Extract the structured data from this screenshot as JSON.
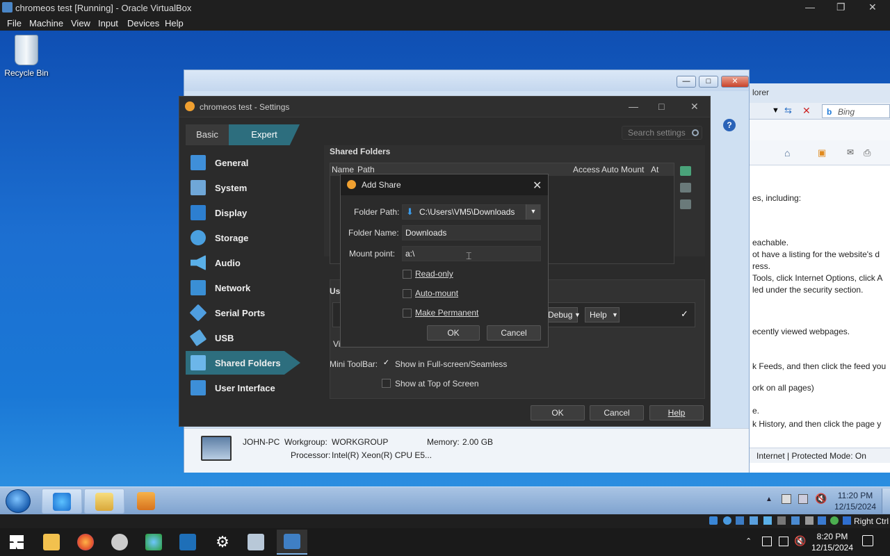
{
  "host": {
    "window_title": "chromeos test [Running] - Oracle VirtualBox",
    "menu": [
      "File",
      "Machine",
      "View",
      "Input",
      "Devices",
      "Help"
    ],
    "status_right": "Right Ctrl",
    "clock_time": "8:20 PM",
    "clock_date": "12/15/2024"
  },
  "desktop": {
    "recycle_bin": "Recycle Bin"
  },
  "ie": {
    "title_partial": "lorer",
    "search_placeholder": "Bing",
    "lines": [
      "es, including:",
      "eachable.",
      "ot have a listing for the website's d",
      "ress.",
      "Tools, click Internet Options, click A",
      "led under the security section.",
      "ecently viewed webpages.",
      "k Feeds, and then click the feed you",
      "ork on all pages)",
      "e.",
      "k History, and then click the page y"
    ],
    "status": "Internet | Protected Mode: On",
    "pc_name": "JOHN-PC",
    "workgroup_label": "Workgroup:",
    "workgroup_value": "WORKGROUP",
    "memory_label": "Memory:",
    "memory_value": "2.00 GB",
    "processor_label": "Processor:",
    "processor_value": "Intel(R) Xeon(R) CPU E5..."
  },
  "settings": {
    "title": "chromeos test - Settings",
    "tab_basic": "Basic",
    "tab_expert": "Expert",
    "search_placeholder": "Search settings",
    "nav": [
      {
        "label": "General",
        "icon": "general-icon",
        "color": "#3f8fd9"
      },
      {
        "label": "System",
        "icon": "system-icon",
        "color": "#6fa7d8"
      },
      {
        "label": "Display",
        "icon": "display-icon",
        "color": "#2d7fd0"
      },
      {
        "label": "Storage",
        "icon": "storage-icon",
        "color": "#4aa0e0"
      },
      {
        "label": "Audio",
        "icon": "audio-icon",
        "color": "#5ab0e8"
      },
      {
        "label": "Network",
        "icon": "network-icon",
        "color": "#3a8fd5"
      },
      {
        "label": "Serial Ports",
        "icon": "serial-ports-icon",
        "color": "#4f9ee0"
      },
      {
        "label": "USB",
        "icon": "usb-icon",
        "color": "#5aa8e0"
      },
      {
        "label": "Shared Folders",
        "icon": "shared-folders-icon",
        "color": "#6cb6ea"
      },
      {
        "label": "User Interface",
        "icon": "user-interface-icon",
        "color": "#3d8fd8"
      }
    ],
    "shared_folders_heading": "Shared Folders",
    "table_headers": [
      "Name",
      "Path",
      "Access",
      "Auto Mount",
      "At"
    ],
    "ui_heading": "Us",
    "debug_label": "Debug",
    "help_small": "Help",
    "vi_label": "Vi",
    "mini_toolbar_label": "Mini ToolBar:",
    "show_fullscreen": "Show in Full-screen/Seamless",
    "show_top": "Show at Top of Screen",
    "ok": "OK",
    "cancel": "Cancel",
    "help": "Help"
  },
  "add_share": {
    "title": "Add Share",
    "folder_path_label": "Folder Path:",
    "folder_path_value": "C:\\Users\\VM5\\Downloads",
    "folder_name_label": "Folder Name:",
    "folder_name_value": "Downloads",
    "mount_point_label": "Mount point:",
    "mount_point_value": "a:\\",
    "read_only": "Read-only",
    "auto_mount": "Auto-mount",
    "make_permanent": "Make Permanent",
    "ok": "OK",
    "cancel": "Cancel"
  },
  "guest_taskbar": {
    "clock_time": "11:20 PM",
    "clock_date": "12/15/2024"
  }
}
